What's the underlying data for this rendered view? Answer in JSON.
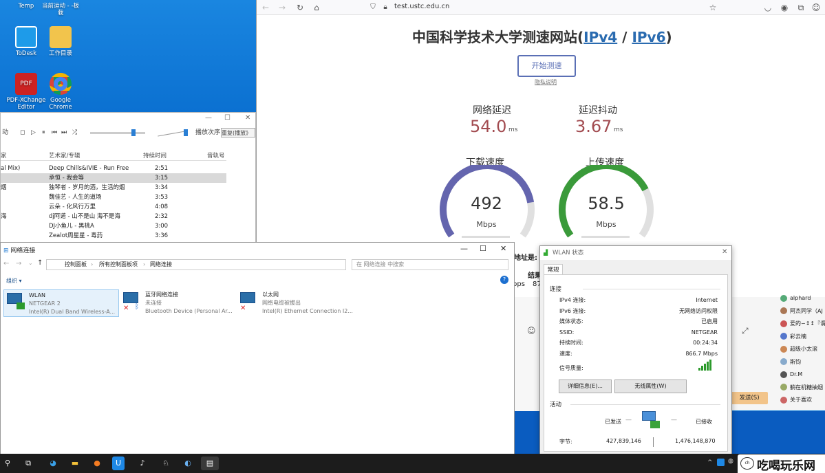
{
  "desktop": {
    "icons": [
      {
        "label": "Temp"
      },
      {
        "label": "当前运动 - -板栽"
      },
      {
        "label": "ToDesk"
      },
      {
        "label": "工作目录"
      },
      {
        "label": "PDF-XChange Editor"
      },
      {
        "label": "Google Chrome"
      }
    ]
  },
  "player": {
    "order_label": "播放次序:",
    "order_value": "重复(播放》",
    "headers": [
      "家",
      "艺术家/专辑",
      "持续时间",
      "音轨号"
    ],
    "rows": [
      {
        "title": "al Mix)",
        "artist": "Deep Chills&IVIE - Run Free",
        "dur": "2:51"
      },
      {
        "title": "",
        "artist": "承恒 - 我会等",
        "dur": "3:15"
      },
      {
        "title": "烟",
        "artist": "独琴者 - 岁月的酒，生活的烟",
        "dur": "3:34"
      },
      {
        "title": "",
        "artist": "魏佳艺 - 人生的道场",
        "dur": "3:53"
      },
      {
        "title": "",
        "artist": "云朵 - 化风行万里",
        "dur": "4:08"
      },
      {
        "title": "海",
        "artist": "dj阿诺 - 山不是山 海不是海",
        "dur": "2:32"
      },
      {
        "title": "",
        "artist": "DJ小鱼儿 - 黑桃A",
        "dur": "3:00"
      },
      {
        "title": "",
        "artist": "Zealot周星星 - 毒药",
        "dur": "3:36"
      }
    ],
    "left_label": "动"
  },
  "browser": {
    "url": "test.ustc.edu.cn",
    "title_prefix": "中国科学技术大学测速网站(",
    "ipv4": "IPv4",
    "sep": " / ",
    "ipv6": "IPv6",
    "title_suffix": ")",
    "start_btn": "开始测速",
    "privacy": "隐私说明",
    "latency_label": "网络延迟",
    "latency": "54.0",
    "latency_unit": "ms",
    "jitter_label": "延迟抖动",
    "jitter": "3.67",
    "jitter_unit": "ms",
    "down_label": "下载速度",
    "down": "492",
    "down_unit": "Mbps",
    "down_fraction": 0.82,
    "up_label": "上传速度",
    "up": "58.5",
    "up_unit": "Mbps",
    "up_fraction": 0.75,
    "addr_label": "地址是:",
    "frag1": "果",
    "frag2": "结果",
    "frag3": "bps",
    "frag4": "87"
  },
  "explorer": {
    "title": "网络连接",
    "breadcrumb": [
      "控制面板",
      "所有控制面板项",
      "网络连接"
    ],
    "search_placeholder": "在 网络连接 中搜索",
    "organize": "组织 ▾",
    "items": [
      {
        "name": "WLAN",
        "status": "NETGEAR 2",
        "device": "Intel(R) Dual Band Wireless-A..."
      },
      {
        "name": "蓝牙网络连接",
        "status": "未连接",
        "device": "Bluetooth Device (Personal Ar..."
      },
      {
        "name": "以太网",
        "status": "网络电缆被拔出",
        "device": "Intel(R) Ethernet Connection I2..."
      }
    ]
  },
  "wlan": {
    "title": "WLAN 状态",
    "tab": "常规",
    "section_conn": "连接",
    "rows": [
      {
        "k": "IPv4 连接:",
        "v": "Internet"
      },
      {
        "k": "IPv6 连接:",
        "v": "无网络访问权限"
      },
      {
        "k": "媒体状态:",
        "v": "已启用"
      },
      {
        "k": "SSID:",
        "v": "NETGEAR"
      },
      {
        "k": "持续时间:",
        "v": "00:24:34"
      },
      {
        "k": "速度:",
        "v": "866.7 Mbps"
      }
    ],
    "signal_label": "信号质量:",
    "details_btn": "详细信息(E)...",
    "wireless_btn": "无线属性(W)",
    "section_activity": "活动",
    "sent_label": "已发送",
    "recv_label": "已接收",
    "bytes_label": "字节:",
    "sent": "427,839,146",
    "recv": "1,476,148,870"
  },
  "chat": {
    "members": [
      {
        "name": "alphard",
        "color": "#5a7"
      },
      {
        "name": "阿杰同学（AJ",
        "color": "#a75"
      },
      {
        "name": "爱的∽↕↕『谓",
        "color": "#c55"
      },
      {
        "name": "彩云楠",
        "color": "#57c"
      },
      {
        "name": "超级小太滚",
        "color": "#c85"
      },
      {
        "name": "斯钧",
        "color": "#8ac"
      },
      {
        "name": "Dr.M",
        "color": "#555"
      },
      {
        "name": "躺在机糖抽烟",
        "color": "#9a6"
      },
      {
        "name": "关于喜欢",
        "color": "#c66"
      }
    ],
    "send_btn": "发送(S)"
  },
  "watermark": "吃喝玩乐网"
}
